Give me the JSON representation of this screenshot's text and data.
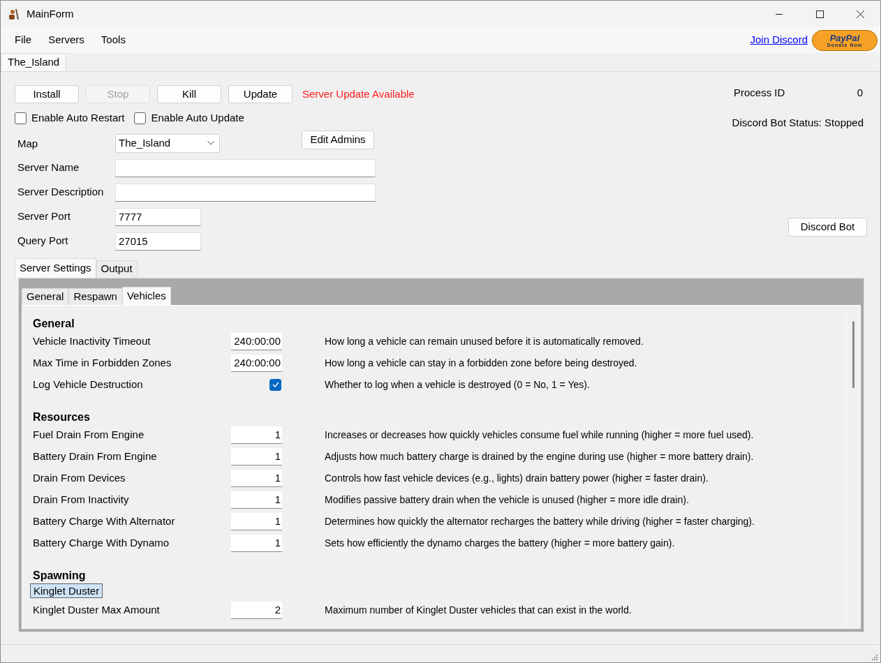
{
  "window": {
    "title": "MainForm"
  },
  "menu": [
    "File",
    "Servers",
    "Tools"
  ],
  "links": {
    "discord": "Join Discord",
    "donate_brand": "PayPal",
    "donate_label": "Donate Now"
  },
  "server_tabs": [
    {
      "label": "The_Island",
      "selected": true
    }
  ],
  "actions": [
    {
      "label": "Install",
      "disabled": false
    },
    {
      "label": "Stop",
      "disabled": true
    },
    {
      "label": "Kill",
      "disabled": false
    },
    {
      "label": "Update",
      "disabled": false
    }
  ],
  "update_notice": "Server Update Available",
  "options": [
    {
      "label": "Enable Auto Restart",
      "checked": false
    },
    {
      "label": "Enable Auto Update",
      "checked": false
    }
  ],
  "map": {
    "label": "Map",
    "value": "The_Island"
  },
  "edit_admins": "Edit Admins",
  "fields": [
    {
      "label": "Server Name",
      "kind": "wide"
    },
    {
      "label": "Server Description",
      "kind": "wide"
    },
    {
      "label": "Server Port",
      "value": "7777",
      "kind": "short"
    },
    {
      "label": "Query Port",
      "value": "27015",
      "kind": "short"
    }
  ],
  "process": {
    "label": "Process ID",
    "value": "0"
  },
  "bot_status": "Discord Bot Status: Stopped",
  "discord_bot_button": "Discord Bot",
  "settings_tabs": [
    {
      "label": "Server Settings",
      "selected": true
    },
    {
      "label": "Output",
      "selected": false
    }
  ],
  "sub_tabs": [
    {
      "label": "General",
      "selected": false
    },
    {
      "label": "Respawn",
      "selected": false
    },
    {
      "label": "Vehicles",
      "selected": true
    }
  ],
  "sections": [
    {
      "title": "General",
      "items": [
        {
          "kind": "input",
          "label": "Vehicle Inactivity Timeout",
          "value": "240:00:00",
          "description": "How long a vehicle can remain unused before it is automatically removed."
        },
        {
          "kind": "input",
          "label": "Max Time in Forbidden Zones",
          "value": "240:00:00",
          "description": "How long a vehicle can stay in a forbidden zone before being destroyed."
        },
        {
          "kind": "checkbox",
          "label": "Log Vehicle Destruction",
          "checked": true,
          "description": "Whether to log when a vehicle is destroyed (0 = No, 1 = Yes)."
        }
      ]
    },
    {
      "title": "Resources",
      "items": [
        {
          "kind": "input",
          "label": "Fuel Drain From Engine",
          "value": "1",
          "description": "Increases or decreases how quickly vehicles consume fuel while running (higher = more fuel used)."
        },
        {
          "kind": "input",
          "label": "Battery Drain From Engine",
          "value": "1",
          "description": "Adjusts how much battery charge is drained by the engine during use (higher = more battery drain)."
        },
        {
          "kind": "input",
          "label": "Drain From Devices",
          "value": "1",
          "description": "Controls how fast vehicle devices (e.g., lights) drain battery power (higher = faster drain)."
        },
        {
          "kind": "input",
          "label": "Drain From Inactivity",
          "value": "1",
          "description": "Modifies passive battery drain when the vehicle is unused (higher = more idle drain)."
        },
        {
          "kind": "input",
          "label": "Battery Charge With Alternator",
          "value": "1",
          "description": "Determines how quickly the alternator recharges the battery while driving (higher = faster charging)."
        },
        {
          "kind": "input",
          "label": "Battery Charge With Dynamo",
          "value": "1",
          "description": "Sets how efficiently the dynamo charges the battery (higher = more battery gain)."
        }
      ]
    },
    {
      "title": "Spawning",
      "items": [
        {
          "kind": "group",
          "label": "Kinglet Duster"
        },
        {
          "kind": "input",
          "label": "Kinglet Duster Max Amount",
          "value": "2",
          "description": "Maximum number of Kinglet Duster vehicles that can exist in the world."
        }
      ]
    }
  ]
}
